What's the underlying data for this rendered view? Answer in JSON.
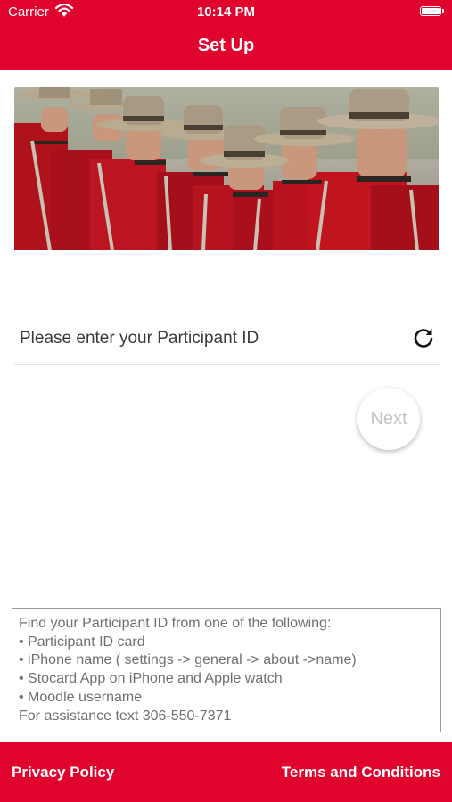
{
  "status_bar": {
    "carrier": "Carrier",
    "time": "10:14 PM"
  },
  "nav": {
    "title": "Set Up"
  },
  "banner": {
    "description_icon": "rcmp-officers-image"
  },
  "form": {
    "participant_id_placeholder": "Please enter your Participant ID",
    "participant_id_value": "",
    "refresh_icon": "refresh-icon",
    "next_label": "Next"
  },
  "info": {
    "lines": [
      "Find your Participant ID from one of the following:",
      "• Participant ID card",
      "• iPhone name ( settings -> general -> about ->name)",
      "• Stocard App on iPhone and Apple watch",
      "• Moodle username",
      "For assistance text 306-550-7371"
    ]
  },
  "footer": {
    "privacy_label": "Privacy Policy",
    "terms_label": "Terms and Conditions"
  },
  "colors": {
    "brand_red": "#e0032d",
    "serge_red": "#b8121f",
    "hat_tan": "#a89a82"
  }
}
